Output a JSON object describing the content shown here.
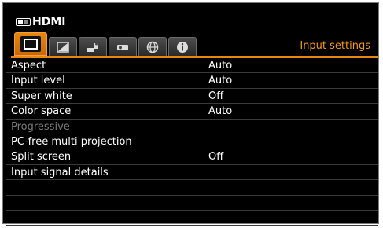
{
  "header": {
    "source": "HDMI",
    "section_title": "Input settings"
  },
  "tabs": [
    {
      "icon": "display-icon",
      "active": true
    },
    {
      "icon": "image-adjust-icon",
      "active": false
    },
    {
      "icon": "setup-icon",
      "active": false
    },
    {
      "icon": "projector-icon",
      "active": false
    },
    {
      "icon": "network-icon",
      "active": false
    },
    {
      "icon": "info-icon",
      "active": false
    }
  ],
  "menu": {
    "items": [
      {
        "label": "Aspect",
        "value": "Auto"
      },
      {
        "label": "Input level",
        "value": "Auto"
      },
      {
        "label": "Super white",
        "value": "Off"
      },
      {
        "label": "Color space",
        "value": "Auto"
      },
      {
        "label": "Progressive",
        "value": ""
      },
      {
        "label": "PC-free multi projection",
        "value": ""
      },
      {
        "label": "Split screen",
        "value": "Off"
      },
      {
        "label": "Input signal details",
        "value": ""
      },
      {
        "label": "",
        "value": ""
      },
      {
        "label": "",
        "value": ""
      },
      {
        "label": "",
        "value": ""
      }
    ]
  },
  "colors": {
    "accent": "#e8860e",
    "section_title": "#f39a1a",
    "disabled_text": "#7a7a7a",
    "background": "#000000"
  }
}
